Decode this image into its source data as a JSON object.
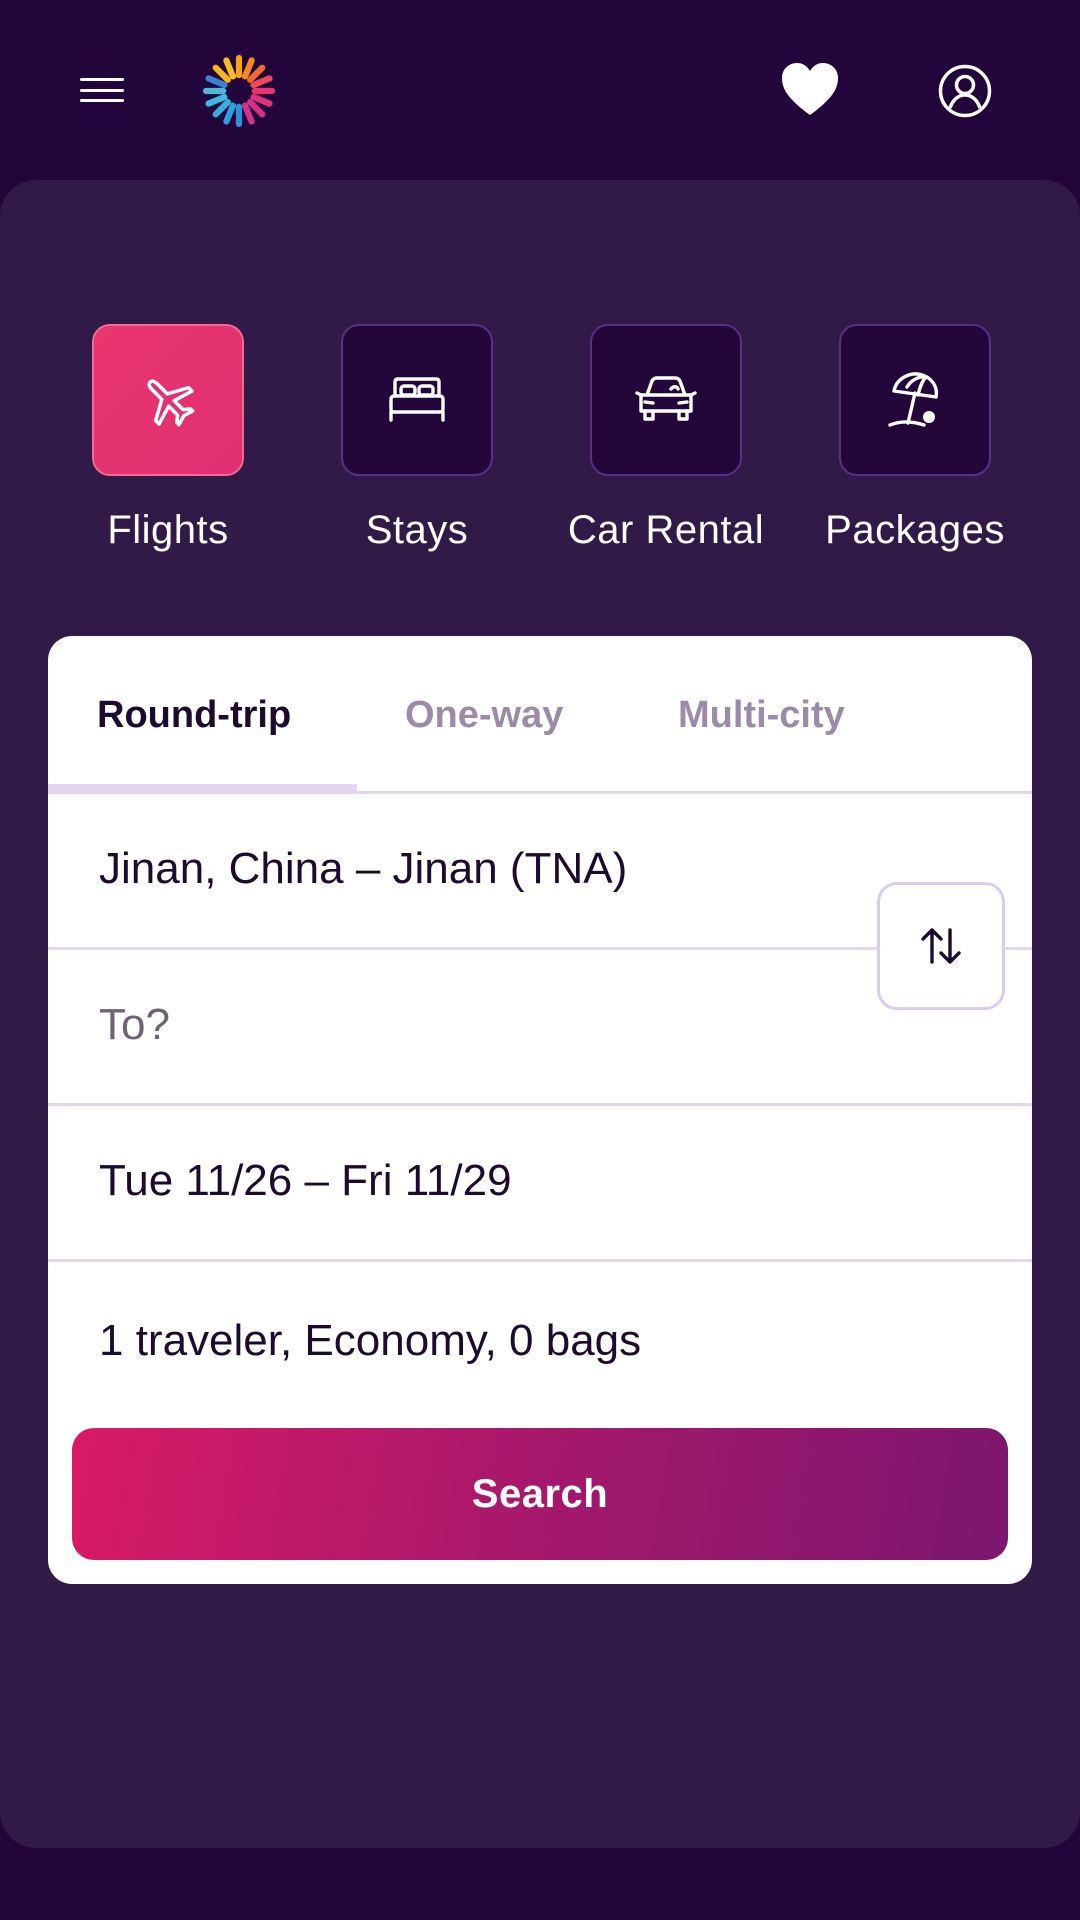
{
  "header": {
    "menu_icon": "hamburger-menu-icon",
    "logo": "colorful-sunburst-logo",
    "favorites_icon": "heart-icon",
    "account_icon": "user-account-icon"
  },
  "categories": [
    {
      "label": "Flights",
      "icon": "airplane-icon",
      "active": true
    },
    {
      "label": "Stays",
      "icon": "bed-icon",
      "active": false
    },
    {
      "label": "Car Rental",
      "icon": "car-icon",
      "active": false
    },
    {
      "label": "Packages",
      "icon": "beach-umbrella-icon",
      "active": false
    }
  ],
  "trip_tabs": [
    {
      "label": "Round-trip",
      "active": true
    },
    {
      "label": "One-way",
      "active": false
    },
    {
      "label": "Multi-city",
      "active": false
    }
  ],
  "form": {
    "origin": "Jinan, China – Jinan (TNA)",
    "destination_placeholder": "To?",
    "dates": "Tue 11/26 – Fri 11/29",
    "travelers": "1 traveler, Economy, 0 bags",
    "swap_icon": "swap-arrows-icon",
    "search_label": "Search"
  },
  "colors": {
    "background": "#21053b",
    "panel": "#311a47",
    "accent": "#e9366f",
    "search_gradient_start": "#d81a65",
    "search_gradient_end": "#7c166e"
  }
}
